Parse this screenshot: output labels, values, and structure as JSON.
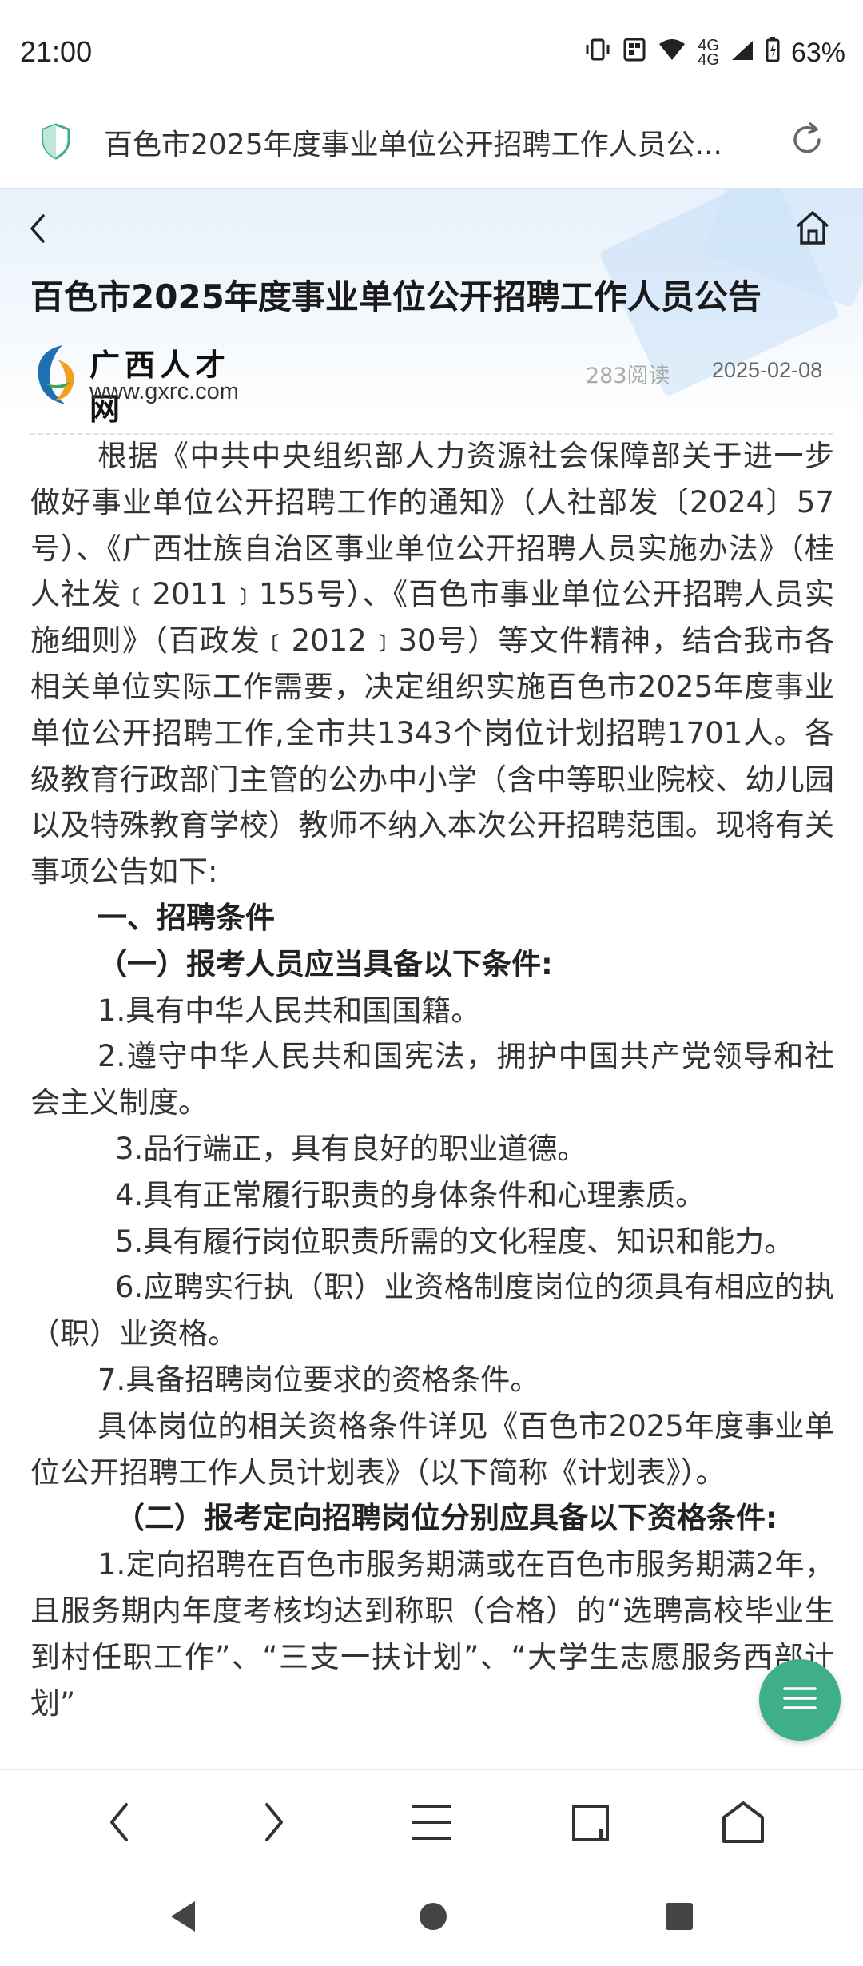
{
  "status_bar": {
    "time": "21:00",
    "net1": "4G",
    "net2": "4G",
    "battery": "63%"
  },
  "browser": {
    "tab_title": "百色市2025年度事业单位公开招聘工作人员公..."
  },
  "article": {
    "title": "百色市2025年度事业单位公开招聘工作人员公告",
    "source_name": "广西人才网",
    "source_url": "www.gxrc.com",
    "reads": "283阅读",
    "date": "2025-02-08",
    "paragraphs": [
      "根据《中共中央组织部人力资源社会保障部关于进一步做好事业单位公开招聘工作的通知》（人社部发〔2024〕57号）、《广西壮族自治区事业单位公开招聘人员实施办法》（桂人社发﹝2011﹞155号）、《百色市事业单位公开招聘人员实施细则》（百政发﹝2012﹞30号）等文件精神，结合我市各相关单位实际工作需要，决定组织实施百色市2025年度事业单位公开招聘工作,全市共1343个岗位计划招聘1701人。各级教育行政部门主管的公办中小学（含中等职业院校、幼儿园以及特殊教育学校）教师不纳入本次公开招聘范围。现将有关事项公告如下:",
      "一、招聘条件",
      "（一）报考人员应当具备以下条件:",
      "1.具有中华人民共和国国籍。",
      "2.遵守中华人民共和国宪法，拥护中国共产党领导和社会主义制度。",
      "3.品行端正，具有良好的职业道德。",
      "4.具有正常履行职责的身体条件和心理素质。",
      "5.具有履行岗位职责所需的文化程度、知识和能力。",
      "6.应聘实行执（职）业资格制度岗位的须具有相应的执（职）业资格。",
      "7.具备招聘岗位要求的资格条件。",
      "具体岗位的相关资格条件详见《百色市2025年度事业单位公开招聘工作人员计划表》（以下简称《计划表》）。",
      "（二）报考定向招聘岗位分别应具备以下资格条件:",
      "1.定向招聘在百色市服务期满或在百色市服务期满2年，且服务期内年度考核均达到称职（合格）的“选聘高校毕业生到村任职工作”、“三支一扶计划”、“大学生志愿服务西部计划”"
    ]
  },
  "colors": {
    "accent": "#3fae8a",
    "header_bg": "#e7f1fb"
  },
  "icons": [
    "shield-icon",
    "reload-icon",
    "back-icon",
    "home-icon",
    "menu-icon",
    "tabs-icon"
  ]
}
